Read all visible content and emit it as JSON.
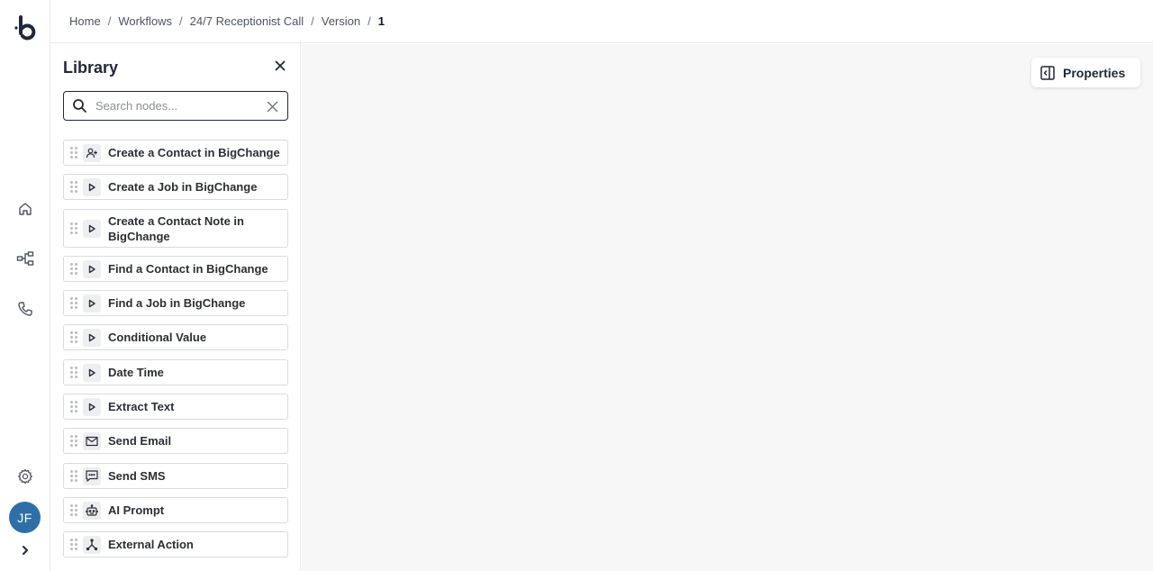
{
  "breadcrumb": {
    "items": [
      "Home",
      "Workflows",
      "24/7 Receptionist Call",
      "Version"
    ],
    "separator": "/",
    "current": "1"
  },
  "rail": {
    "logo_icon": "brand-logo-icon",
    "nav": [
      "home-icon",
      "workflow-icon",
      "phone-icon"
    ],
    "settings_icon": "gear-icon",
    "avatar_initials": "JF",
    "avatar_color": "#2f6fa7",
    "expand_icon": "chevron-right-icon"
  },
  "library": {
    "title": "Library",
    "search": {
      "placeholder": "Search nodes...",
      "value": ""
    },
    "nodes": [
      {
        "label": "Create a Contact in BigChange",
        "icon": "user-plus-icon"
      },
      {
        "label": "Create a Job in BigChange",
        "icon": "play-icon"
      },
      {
        "label": "Create a Contact Note in BigChange",
        "icon": "play-icon"
      },
      {
        "label": "Find a Contact in BigChange",
        "icon": "play-icon"
      },
      {
        "label": "Find a Job in BigChange",
        "icon": "play-icon"
      },
      {
        "label": "Conditional Value",
        "icon": "play-icon"
      },
      {
        "label": "Date Time",
        "icon": "play-icon"
      },
      {
        "label": "Extract Text",
        "icon": "play-icon"
      },
      {
        "label": "Send Email",
        "icon": "mail-icon"
      },
      {
        "label": "Send SMS",
        "icon": "message-icon"
      },
      {
        "label": "AI Prompt",
        "icon": "robot-icon"
      },
      {
        "label": "External Action",
        "icon": "fork-icon"
      }
    ]
  },
  "canvas": {
    "properties_label": "Properties",
    "properties_icon": "panel-left-icon",
    "background": "#f7f7f8"
  }
}
